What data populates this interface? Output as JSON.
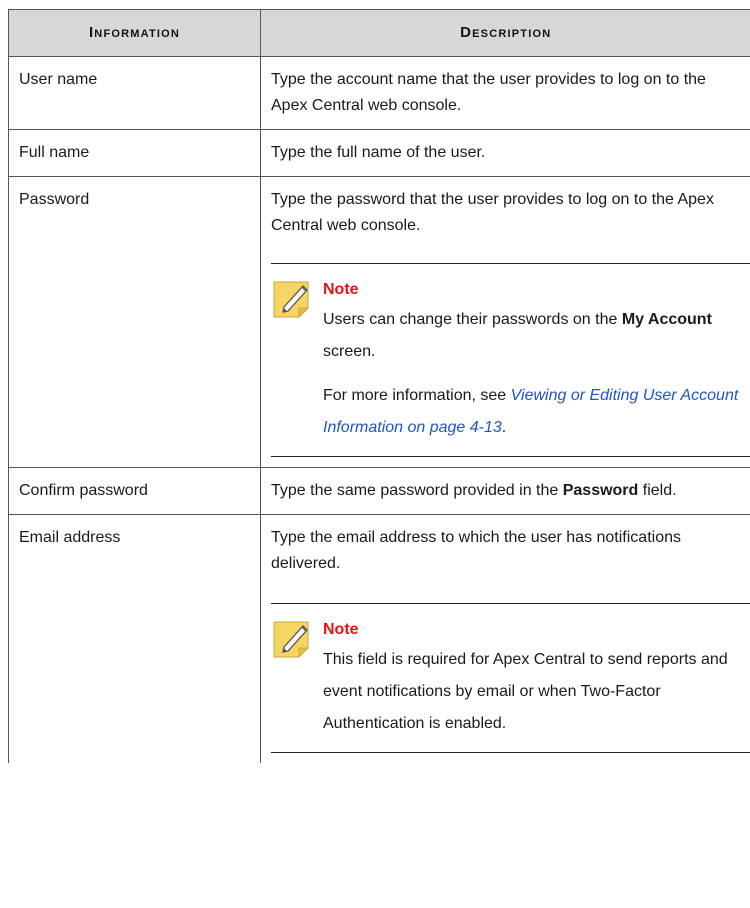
{
  "table": {
    "headers": {
      "information": "Information",
      "description": "Description"
    },
    "rows": {
      "user_name": {
        "label": "User name",
        "description": "Type the account name that the user provides to log on to the Apex Central web console."
      },
      "full_name": {
        "label": "Full name",
        "description": "Type the full name of the user."
      },
      "password": {
        "label": "Password",
        "description": "Type the password that the user provides to log on to the Apex Central web console.",
        "note": {
          "title": "Note",
          "line1_pre": "Users can change their passwords on the ",
          "line1_bold": "My Account",
          "line1_post": " screen.",
          "line2_pre": "For more information, see ",
          "line2_link": "Viewing or Editing User Account Information on page 4-13",
          "line2_post": "."
        }
      },
      "confirm_password": {
        "label": "Confirm password",
        "description_pre": "Type the same password provided in the ",
        "description_bold": "Password",
        "description_post": " field."
      },
      "email_address": {
        "label": "Email address",
        "description": "Type the email address to which the user has notifications delivered.",
        "note": {
          "title": "Note",
          "text": "This field is required for Apex Central to send reports and event notifications by email or when Two-Factor Authentication is enabled."
        }
      }
    }
  },
  "icons": {
    "note_icon": "note-pencil-icon"
  },
  "colors": {
    "header_bg": "#d7d7d7",
    "note_title": "#e31414",
    "link": "#1f55c7",
    "note_icon_fill": "#f7d564"
  }
}
